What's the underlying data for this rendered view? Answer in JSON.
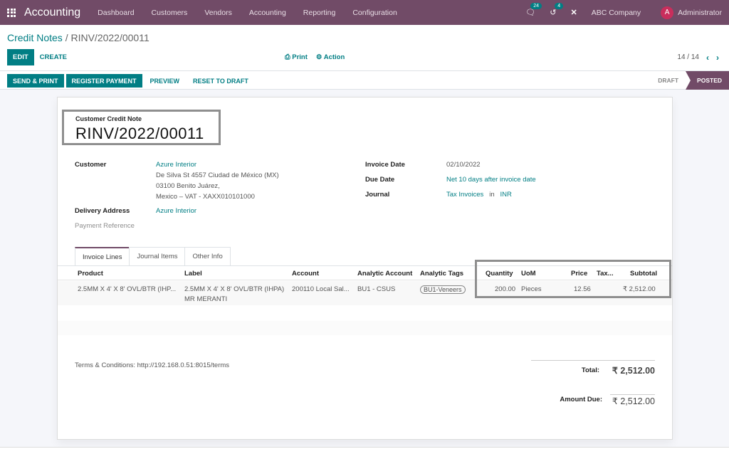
{
  "navbar": {
    "app_name": "Accounting",
    "menu": [
      "Dashboard",
      "Customers",
      "Vendors",
      "Accounting",
      "Reporting",
      "Configuration"
    ],
    "messages_badge": "24",
    "activities_badge": "4",
    "company": "ABC Company",
    "avatar_letter": "A",
    "user": "Administrator",
    "accent_color": "#714b67"
  },
  "breadcrumb": {
    "parent": "Credit Notes",
    "separator": "/",
    "current": "RINV/2022/00011"
  },
  "control": {
    "edit_label": "EDIT",
    "create_label": "CREATE",
    "print_label": "Print",
    "action_label": "Action",
    "pager": "14 / 14"
  },
  "statusbar": {
    "buttons": [
      "SEND & PRINT",
      "REGISTER PAYMENT",
      "PREVIEW",
      "RESET TO DRAFT"
    ],
    "stages": [
      "DRAFT",
      "POSTED"
    ],
    "active_stage": "POSTED"
  },
  "document": {
    "type": "Customer Credit Note",
    "name": "RINV/2022/00011",
    "customer_label": "Customer",
    "customer_name": "Azure Interior",
    "customer_address": [
      "De Silva St 4557 Ciudad de México (MX)",
      "03100 Benito Juárez,",
      "Mexico – VAT - XAXX010101000"
    ],
    "delivery_label": "Delivery Address",
    "delivery_value": "Azure Interior",
    "payment_ref_label": "Payment Reference",
    "invoice_date_label": "Invoice Date",
    "invoice_date": "02/10/2022",
    "due_date_label": "Due Date",
    "due_date": "Net 10 days after invoice date",
    "journal_label": "Journal",
    "journal": "Tax Invoices",
    "journal_in": "in",
    "currency": "INR"
  },
  "tabs": [
    "Invoice Lines",
    "Journal Items",
    "Other Info"
  ],
  "table": {
    "headers": [
      "Product",
      "Label",
      "Account",
      "Analytic Account",
      "Analytic Tags",
      "Quantity",
      "UoM",
      "Price",
      "Tax...",
      "Subtotal"
    ],
    "rows": [
      {
        "product": "2.5MM X 4' X 8' OVL/BTR (IHP...",
        "label_line1": "2.5MM X 4' X 8' OVL/BTR (IHPA)",
        "label_line2": "MR MERANTI",
        "account": "200110 Local Sal...",
        "analytic_account": "BU1 - CSUS",
        "analytic_tag": "BU1-Veneers",
        "quantity": "200.00",
        "uom": "Pieces",
        "price": "12.56",
        "taxes": "",
        "subtotal": "₹ 2,512.00"
      }
    ]
  },
  "footer": {
    "terms": "Terms & Conditions: http://192.168.0.51:8015/terms",
    "total_label": "Total:",
    "total_value": "₹ 2,512.00",
    "amount_due_label": "Amount Due:",
    "amount_due_value": "₹ 2,512.00"
  }
}
